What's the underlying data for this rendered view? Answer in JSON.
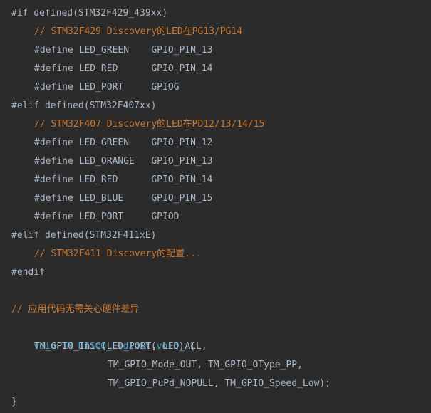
{
  "code": {
    "lines": [
      "#if defined(STM32F429_439xx)",
      "// STM32F429 Discovery的LED在PG13/PG14",
      "#define LED_GREEN    GPIO_PIN_13",
      "#define LED_RED      GPIO_PIN_14",
      "#define LED_PORT     GPIOG",
      "#elif defined(STM32F407xx)",
      "// STM32F407 Discovery的LED在PD12/13/14/15",
      "#define LED_GREEN    GPIO_PIN_12",
      "#define LED_ORANGE   GPIO_PIN_13",
      "#define LED_RED      GPIO_PIN_14",
      "#define LED_BLUE     GPIO_PIN_15",
      "#define LED_PORT     GPIOD",
      "#elif defined(STM32F411xE)",
      "// STM32F411 Discovery的配置...",
      "#endif",
      "",
      "// 应用代码无需关心硬件差异",
      {
        "keyword": "void",
        "space1": " ",
        "func": "TM_DISCO_LedInit",
        "open": "(",
        "arg": "void",
        "close": ")",
        "brace": " {"
      },
      "TM_GPIO_Init(LED_PORT, LED_ALL,",
      "TM_GPIO_Mode_OUT, TM_GPIO_OType_PP,",
      "TM_GPIO_PuPd_NOPULL, TM_GPIO_Speed_Low);",
      "}"
    ]
  },
  "colors": {
    "background": "#2b2b2b",
    "plain_text": "#a9b7c6",
    "comment": "#cc7832",
    "keyword": "#3ea7d6"
  }
}
